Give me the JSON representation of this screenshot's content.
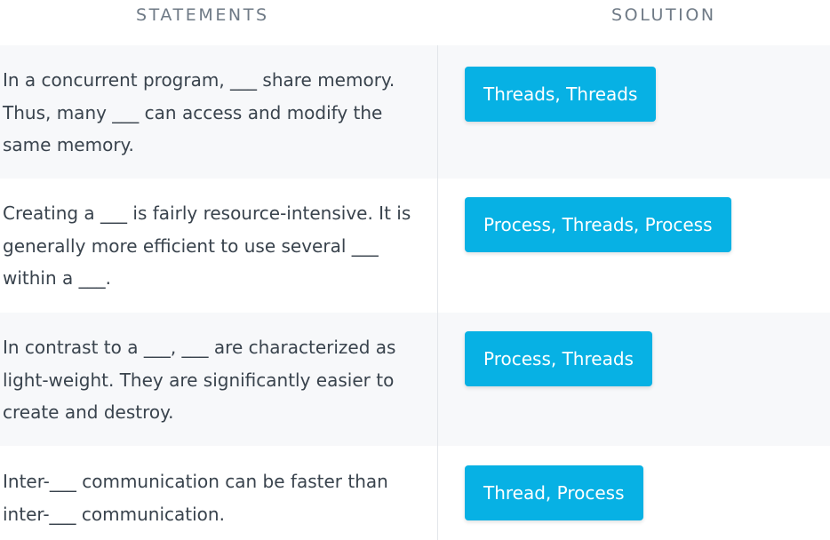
{
  "header": {
    "statements_label": "STATEMENTS",
    "solution_label": "SOLUTION"
  },
  "rows": [
    {
      "statement_lines": [
        "In a concurrent program, ___ share memory.",
        "Thus, many ___ can access and modify the",
        "same memory."
      ],
      "solution": "Threads, Threads"
    },
    {
      "statement_lines": [
        "Creating a ___ is fairly resource-intensive. It is",
        "generally more efficient to use several ___",
        "within a ___."
      ],
      "solution": "Process, Threads, Process"
    },
    {
      "statement_lines": [
        "In contrast to a ___, ___ are characterized as",
        "light-weight. They are significantly easier to",
        "create and destroy."
      ],
      "solution": "Process, Threads"
    },
    {
      "statement_lines": [
        "Inter-___ communication can be faster than",
        "inter-___ communication."
      ],
      "solution": "Thread, Process"
    }
  ],
  "colors": {
    "accent": "#07b1e4",
    "alt_row": "#f7f8fa",
    "text": "#39434d",
    "header_text": "#6f7a86"
  }
}
